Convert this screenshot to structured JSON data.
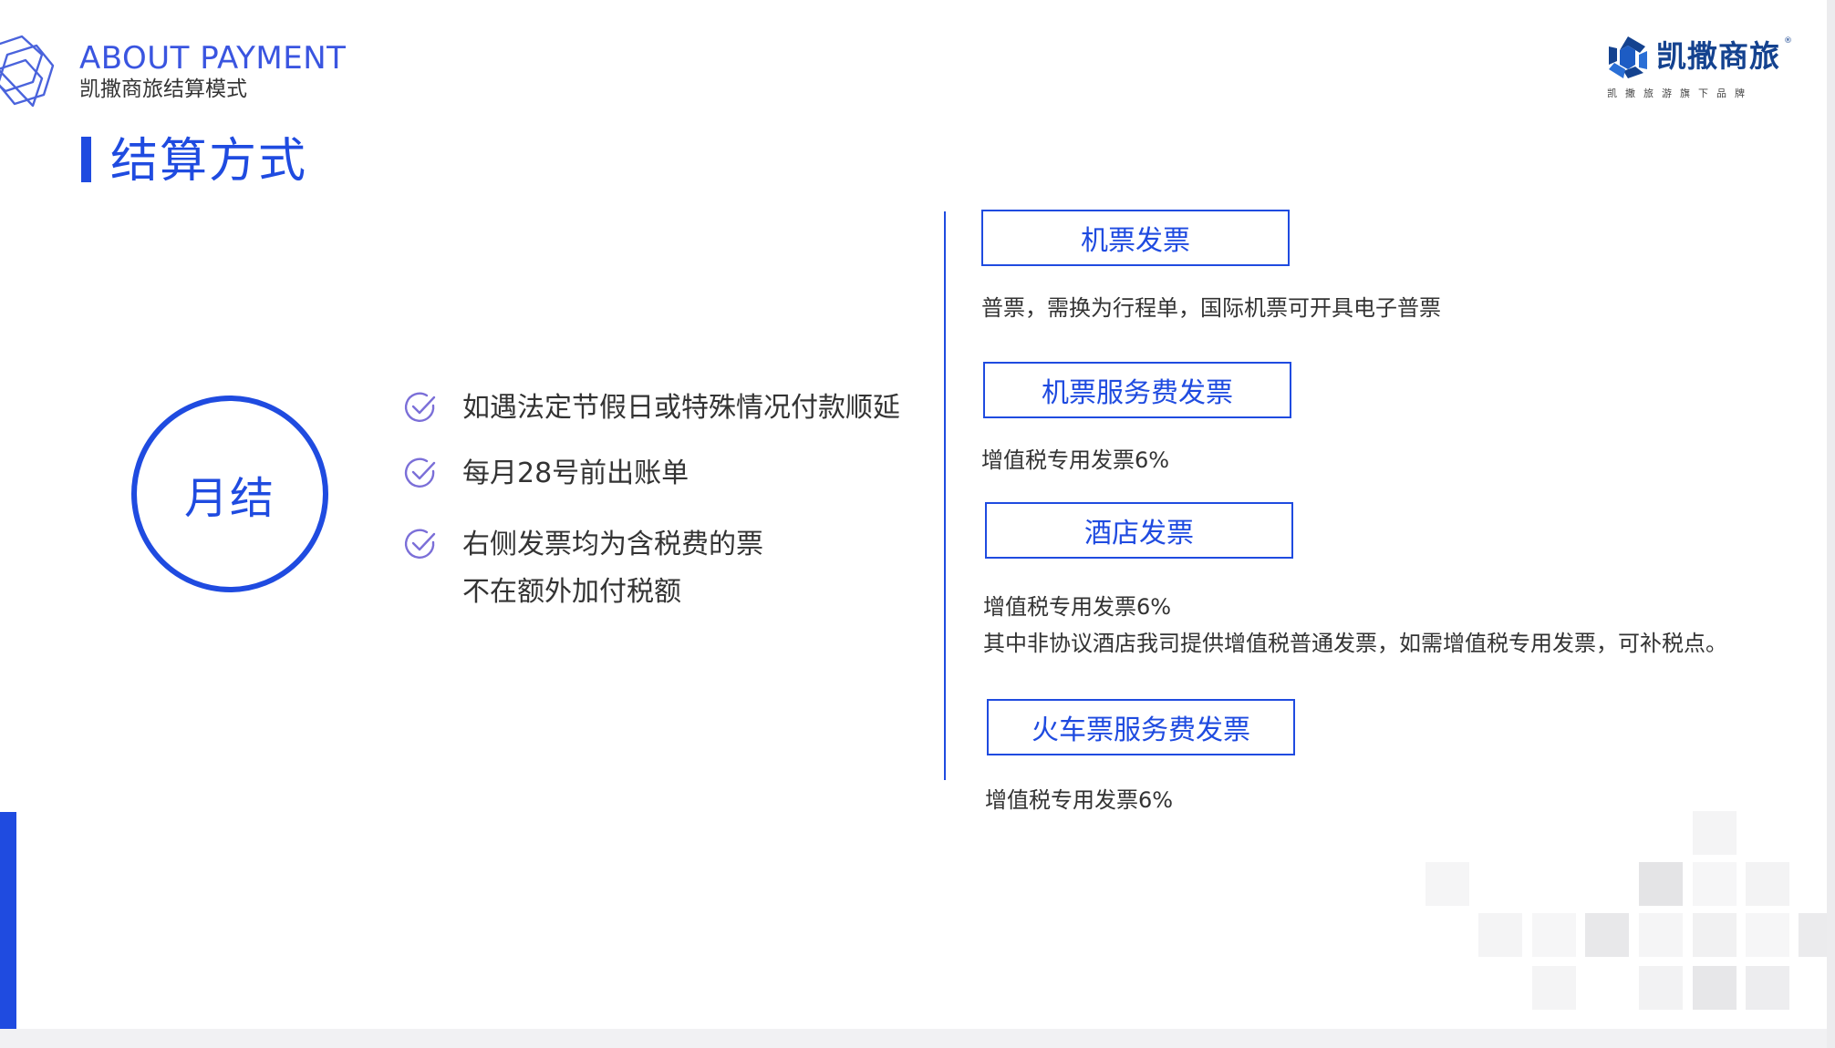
{
  "colors": {
    "accent": "#1f4be0",
    "header_accent": "#3a55e0",
    "brand_navy": "#14428f",
    "text": "#333333",
    "check_stroke": "#7b6fd8"
  },
  "header": {
    "logo_icon": "hexagon-outline-logo-icon",
    "title": "ABOUT PAYMENT",
    "subtitle": "凯撒商旅结算模式"
  },
  "brand": {
    "icon": "kaisa-brand-mark-icon",
    "name": "凯撒商旅",
    "registered": "®",
    "tagline": "凯撒旅游旗下品牌"
  },
  "section": {
    "title": "结算方式"
  },
  "circle": {
    "label": "月结"
  },
  "checklist": {
    "icon": "check-circle-icon",
    "items": [
      {
        "line1": "如遇法定节假日或特殊情况付款顺延"
      },
      {
        "line1": "每月28号前出账单"
      },
      {
        "line1": "右侧发票均为含税费的票",
        "line2": "不在额外加付税额"
      }
    ]
  },
  "invoices": [
    {
      "label": "机票发票",
      "desc": [
        "普票，需换为行程单，国际机票可开具电子普票"
      ]
    },
    {
      "label": "机票服务费发票",
      "desc": [
        "增值税专用发票6%"
      ]
    },
    {
      "label": "酒店发票",
      "desc": [
        "增值税专用发票6%",
        "其中非协议酒店我司提供增值税普通发票，如需增值税专用发票，可补税点。"
      ]
    },
    {
      "label": "火车票服务费发票",
      "desc": [
        "增值税专用发票6%"
      ]
    }
  ]
}
